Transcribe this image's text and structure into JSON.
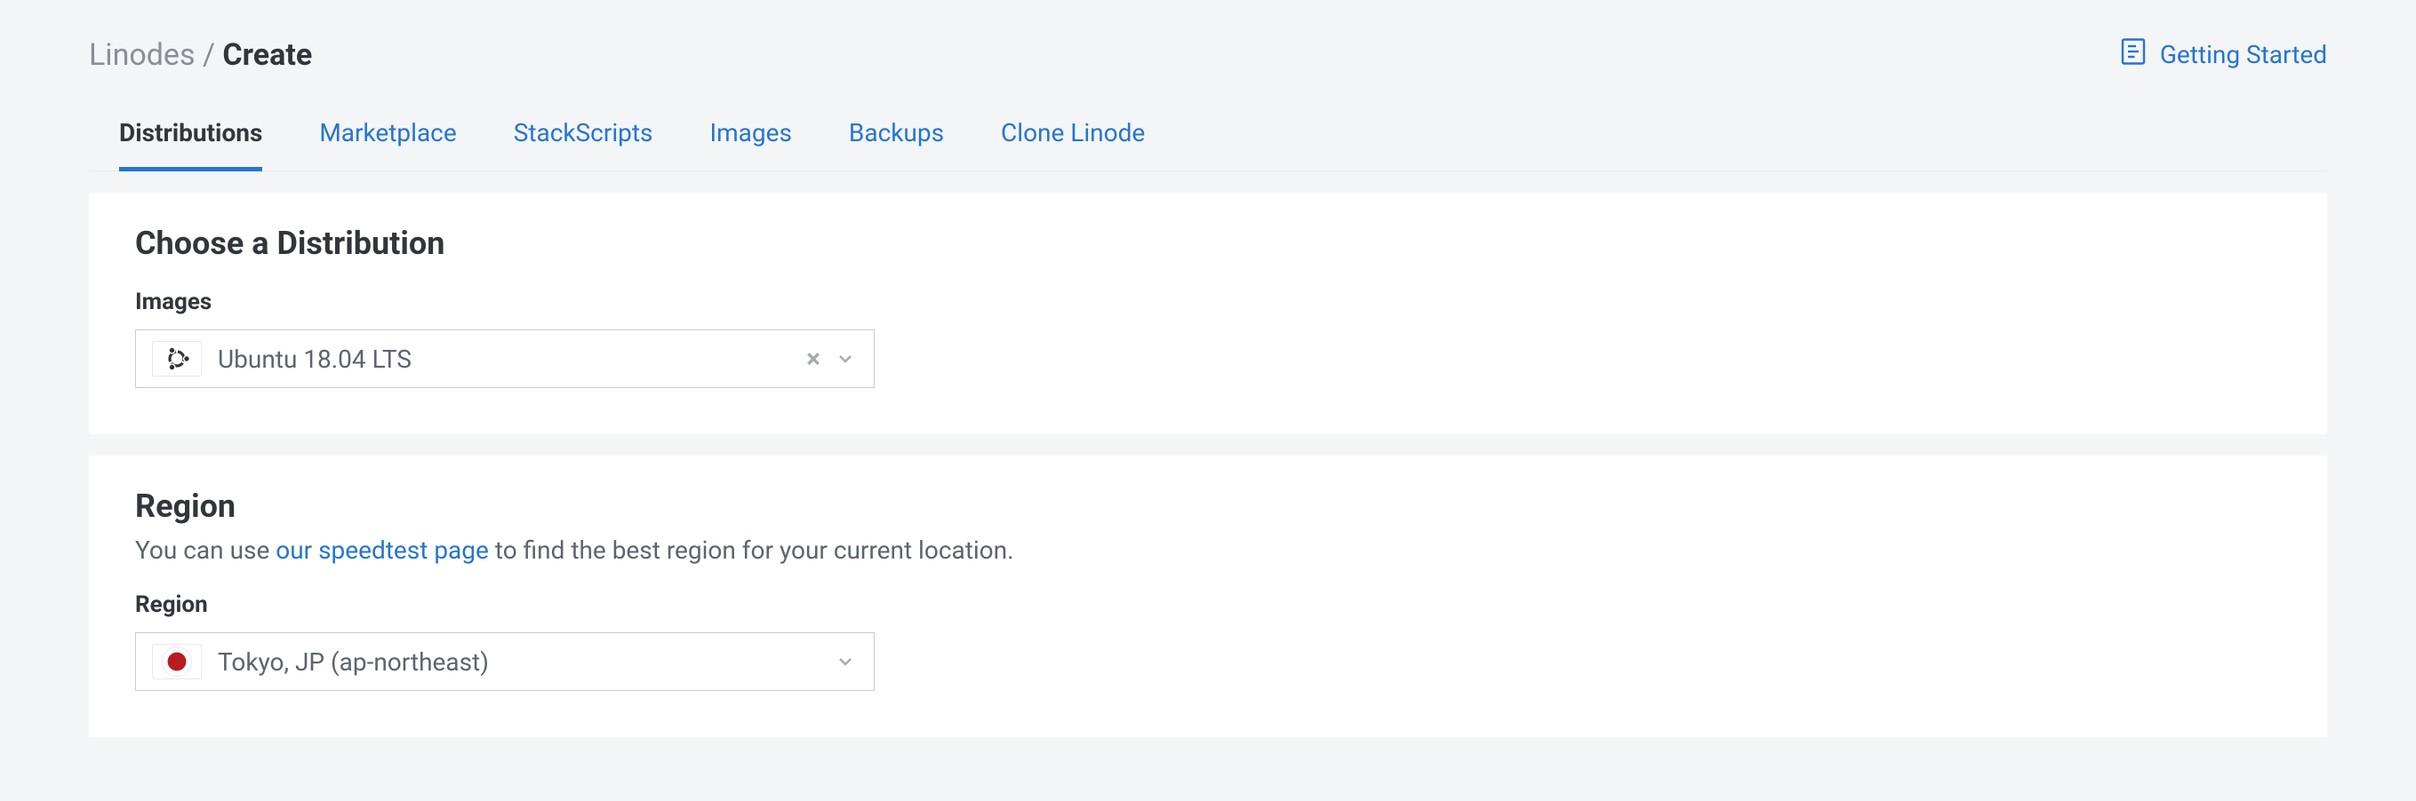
{
  "breadcrumb": {
    "parent": "Linodes",
    "separator": "/",
    "current": "Create"
  },
  "header_link": {
    "label": "Getting Started"
  },
  "tabs": [
    {
      "label": "Distributions",
      "active": true
    },
    {
      "label": "Marketplace",
      "active": false
    },
    {
      "label": "StackScripts",
      "active": false
    },
    {
      "label": "Images",
      "active": false
    },
    {
      "label": "Backups",
      "active": false
    },
    {
      "label": "Clone Linode",
      "active": false
    }
  ],
  "distribution_card": {
    "heading": "Choose a Distribution",
    "field_label": "Images",
    "selected": "Ubuntu 18.04 LTS",
    "icon": "ubuntu-icon"
  },
  "region_card": {
    "heading": "Region",
    "subtitle_pre": "You can use ",
    "subtitle_link": "our speedtest page",
    "subtitle_post": " to find the best region for your current location.",
    "field_label": "Region",
    "selected": "Tokyo, JP (ap-northeast)",
    "icon": "japan-flag"
  }
}
